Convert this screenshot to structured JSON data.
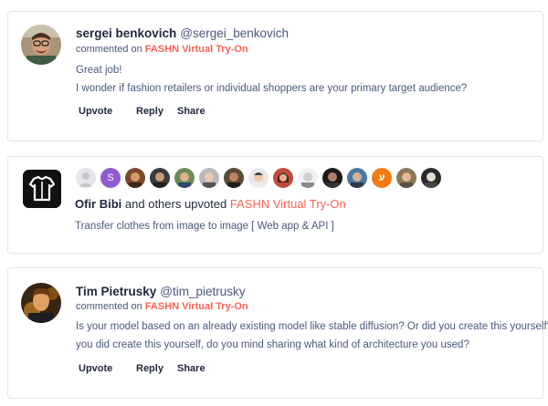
{
  "comments": [
    {
      "username": "sergei benkovich",
      "handle": "@sergei_benkovich",
      "meta_prefix": "commented on",
      "product": "FASHN Virtual Try-On",
      "lines": [
        "Great job!",
        "I wonder if fashion retailers or individual shoppers are your primary target audience?"
      ],
      "actions": {
        "upvote": "Upvote",
        "reply": "Reply",
        "share": "Share"
      }
    },
    {
      "username": "Tim Pietrusky",
      "handle": "@tim_pietrusky",
      "meta_prefix": "commented on",
      "product": "FASHN Virtual Try-On",
      "lines": [
        "Is your model based on an already existing model like stable diffusion? Or did you create this yourself? If",
        "you did create this yourself, do you mind sharing what kind of architecture you used?"
      ],
      "actions": {
        "upvote": "Upvote",
        "reply": "Reply",
        "share": "Share"
      }
    }
  ],
  "upvote_card": {
    "voter_initial": "S",
    "voter_initial_2": "ע",
    "name": "Ofir Bibi",
    "middle": "and others upvoted",
    "product": "FASHN Virtual Try-On",
    "description": "Transfer clothes from image to image [ Web app & API ]"
  },
  "colors": {
    "accent": "#ff6154",
    "text": "#21293c",
    "muted": "#4b587c",
    "border": "#e3e5e8"
  }
}
